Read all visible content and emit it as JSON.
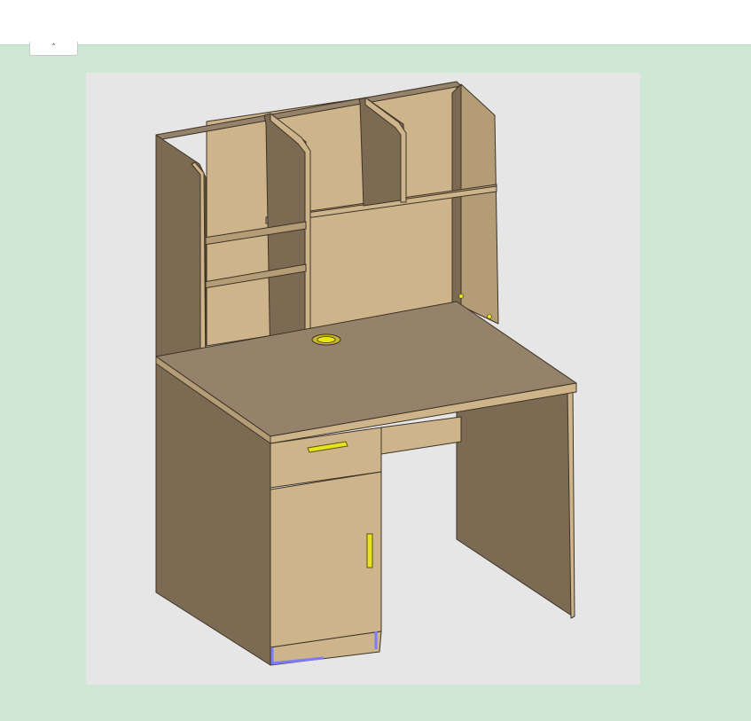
{
  "colors": {
    "panel_background": "#cfe8d5",
    "viewport_background": "#e6e6e6",
    "wood_light": "#cdb48b",
    "wood_mid": "#b49c77",
    "wood_dark": "#7c6b53",
    "wood_top": "#94826a",
    "edge_line": "#3d3326",
    "handle": "#e8e41a",
    "highlight": "#7b7bff"
  },
  "controls": {
    "collapse_button": {
      "glyph": "˄",
      "icon": "chevron-up-icon"
    }
  },
  "viewport": {
    "model": "desk-with-hutch",
    "parts": [
      "hutch-left-side",
      "hutch-middle-divider",
      "hutch-center-divider",
      "hutch-right-side",
      "hutch-top-shelf",
      "hutch-left-shelf",
      "desktop",
      "drawer-front",
      "drawer-handle",
      "cabinet-door",
      "door-handle",
      "cable-grommet",
      "right-leg-panel",
      "plinth"
    ]
  }
}
